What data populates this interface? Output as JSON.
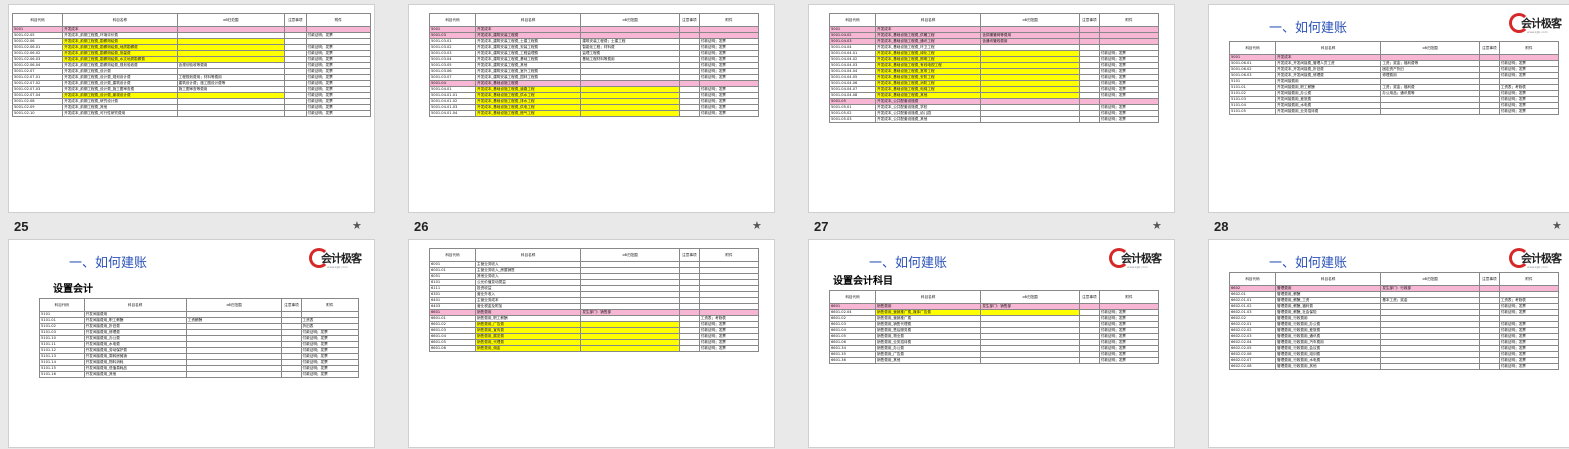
{
  "page_numbers": [
    "25",
    "26",
    "27",
    "28"
  ],
  "heading": "一、如何建账",
  "subheadings": {
    "s5": "设置会计",
    "s7": "设置会计科目"
  },
  "logo_text": "会计极客",
  "logo_url": "www.kjjk.com",
  "headers": [
    "科目代码",
    "科目名称",
    "об归范围",
    "注意事项",
    "附件"
  ],
  "slide1_rows": [
    {
      "code": "5001",
      "name": "开发成本",
      "pink": true
    },
    {
      "code": "5001.02.05",
      "name": "开发成本_前期工程费_环境评价费",
      "scope": "",
      "att": "付款证明；发票"
    },
    {
      "code": "5001.02.06",
      "name": "开发成本_前期工程费_勘察测绘费",
      "y": true
    },
    {
      "code": "5001.02.06.01",
      "name": "开发成本_前期工程费_勘察测绘费_地质勘察费",
      "y": true,
      "att": "付款证明；发票"
    },
    {
      "code": "5001.02.06.02",
      "name": "开发成本_前期工程费_勘察测绘费_测量费",
      "y": true,
      "att": "付款证明；发票"
    },
    {
      "code": "5001.02.06.03",
      "name": "开发成本_前期工程费_勘察测绘费_水文地质勘察费",
      "y": true,
      "att": "付款证明；发票"
    },
    {
      "code": "5001.02.06.04",
      "name": "开发成本_前期工程费_勘察测绘费_规划验收费",
      "scope": "含规划验收等费用",
      "att": "付款证明；发票"
    },
    {
      "code": "5001.02.07",
      "name": "开发成本_前期工程费_设计费",
      "att": "付款证明；发票"
    },
    {
      "code": "5001.02.07.01",
      "name": "开发成本_前期工程费_设计费_规划设计费",
      "scope": "工程规划费用；材料等费用",
      "att": "付款证明；发票"
    },
    {
      "code": "5001.02.07.02",
      "name": "开发成本_前期工程费_设计费_建筑设计费",
      "scope": "建筑设计费；施工图设计费等",
      "att": "付款证明；发票"
    },
    {
      "code": "5001.02.07.03",
      "name": "开发成本_前期工程费_设计费_施工图审查费",
      "scope": "施工图审查等费用",
      "att": "付款证明；发票"
    },
    {
      "code": "5001.02.07.04",
      "name": "开发成本_前期工程费_设计费_景观设计费",
      "y": true,
      "att": "付款证明；发票"
    },
    {
      "code": "5001.02.08",
      "name": "开发成本_前期工程费_研究设计费",
      "att": "付款证明；发票"
    },
    {
      "code": "5001.02.09",
      "name": "开发成本_前期工程费_其他",
      "att": "付款证明；发票"
    },
    {
      "code": "5001.02.10",
      "name": "开发成本_前期工程费_可行性研究费用",
      "att": "付款证明；发票"
    }
  ],
  "slide2_rows": [
    {
      "code": "5001",
      "name": "开发成本",
      "pink": true
    },
    {
      "code": "5001.03",
      "name": "开发成本_建筑安装工程费",
      "pink": true
    },
    {
      "code": "5001.03.01",
      "name": "开发成本_建筑安装工程费_土建工程费",
      "scope": "建筑安装工程费；土建工程",
      "att": "付款证明；发票"
    },
    {
      "code": "5001.03.02",
      "name": "开发成本_建筑安装工程费_安装工程费",
      "scope": "智能化工程；材料费",
      "att": "付款证明；发票"
    },
    {
      "code": "5001.03.03",
      "name": "开发成本_建筑安装工程费_工程监理费",
      "scope": "监理工程费",
      "att": "付款证明；发票"
    },
    {
      "code": "5001.03.04",
      "name": "开发成本_建筑安装工程费_基础工程费",
      "scope": "基础工程材料等费用",
      "att": "付款证明；发票"
    },
    {
      "code": "5001.03.05",
      "name": "开发成本_建筑安装工程费_其他",
      "att": "付款证明；发票"
    },
    {
      "code": "5001.03.06",
      "name": "开发成本_建筑安装工程费_室外工程费",
      "att": "付款证明；发票"
    },
    {
      "code": "5001.03.07",
      "name": "开发成本_建筑安装工程费_园林工程费",
      "att": "付款证明；发票"
    },
    {
      "code": "5001.04",
      "name": "开发成本_基础设施工程费",
      "pink": true
    },
    {
      "code": "5001.04.01",
      "name": "开发成本_基础设施工程费_道路工程",
      "y": true,
      "att": "付款证明；发票"
    },
    {
      "code": "5001.04.01.01",
      "name": "开发成本_基础设施工程费_供水工程",
      "y": true,
      "att": "付款证明；发票"
    },
    {
      "code": "5001.04.01.02",
      "name": "开发成本_基础设施工程费_排水工程",
      "y": true,
      "att": "付款证明；发票"
    },
    {
      "code": "5001.04.01.03",
      "name": "开发成本_基础设施工程费_供电工程",
      "y": true,
      "att": "付款证明；发票"
    },
    {
      "code": "5001.04.01.04",
      "name": "开发成本_基础设施工程费_燃气工程",
      "y": true,
      "att": "付款证明；发票"
    }
  ],
  "slide3_rows": [
    {
      "code": "5001",
      "name": "开发成本",
      "pink": true
    },
    {
      "code": "5001.04.02",
      "name": "开发成本_基础设施工程费_供暖工程",
      "scope": "含供暖管网等费用",
      "pink": true
    },
    {
      "code": "5001.04.03",
      "name": "开发成本_基础设施工程费_通讯工程",
      "scope": "含通讯管线费用",
      "pink": true
    },
    {
      "code": "5001.04.04",
      "name": "开发成本_基础设施工程费_环卫工程"
    },
    {
      "code": "5001.04.04.01",
      "name": "开发成本_基础设施工程费_绿化工程",
      "y": true,
      "att": "付款证明；发票"
    },
    {
      "code": "5001.04.04.02",
      "name": "开发成本_基础设施工程费_照明工程",
      "y": true,
      "att": "付款证明；发票"
    },
    {
      "code": "5001.04.04.03",
      "name": "开发成本_基础设施工程费_有线电视工程",
      "y": true,
      "att": "付款证明；发票"
    },
    {
      "code": "5001.04.04.04",
      "name": "开发成本_基础设施工程费_宽带工程",
      "y": true,
      "att": "付款证明；发票"
    },
    {
      "code": "5001.04.04.05",
      "name": "开发成本_基础设施工程费_安防工程",
      "y": true,
      "att": "付款证明；发票"
    },
    {
      "code": "5001.04.04.06",
      "name": "开发成本_基础设施工程费_消防工程",
      "y": true,
      "att": "付款证明；发票"
    },
    {
      "code": "5001.04.04.07",
      "name": "开发成本_基础设施工程费_电梯工程",
      "y": true,
      "att": "付款证明；发票"
    },
    {
      "code": "5001.04.04.08",
      "name": "开发成本_基础设施工程费_其他",
      "y": true,
      "att": "付款证明；发票"
    },
    {
      "code": "5001.05",
      "name": "开发成本_公共配套设施费",
      "pink": true
    },
    {
      "code": "5001.05.01",
      "name": "开发成本_公共配套设施费_学校",
      "att": "付款证明；发票"
    },
    {
      "code": "5001.05.02",
      "name": "开发成本_公共配套设施费_幼儿园",
      "att": "付款证明；发票"
    },
    {
      "code": "5001.05.03",
      "name": "开发成本_公共配套设施费_其他",
      "att": "付款证明；发票"
    }
  ],
  "slide4_rows": [
    {
      "code": "5001",
      "name": "开发成本",
      "pink": true
    },
    {
      "code": "5001.06.01",
      "name": "开发成本_开发间接费_管理人员工资",
      "scope": "工资；奖金；福利费等",
      "att": "付款证明；发票"
    },
    {
      "code": "5001.06.02",
      "name": "开发成本_开发间接费_折旧费",
      "scope": "固定资产折旧",
      "att": "付款证明；发票"
    },
    {
      "code": "5001.06.03",
      "name": "开发成本_开发间接费_修理费",
      "scope": "修理费用",
      "att": "付款证明；发票"
    },
    {
      "code": "5101",
      "name": "开发间接费用"
    },
    {
      "code": "5101.01",
      "name": "开发间接费用_职工薪酬",
      "scope": "工资；奖金；福利费",
      "att": "工资表；考勤表"
    },
    {
      "code": "5101.02",
      "name": "开发间接费用_办公费",
      "scope": "办公用品；通讯费等",
      "att": "付款证明；发票"
    },
    {
      "code": "5101.03",
      "name": "开发间接费用_差旅费",
      "att": "付款证明；发票"
    },
    {
      "code": "5101.04",
      "name": "开发间接费用_水电费",
      "att": "付款证明；发票"
    },
    {
      "code": "5101.05",
      "name": "开发间接费用_业务招待费",
      "att": "付款证明；发票"
    }
  ],
  "slide5_rows": [
    {
      "code": "5101",
      "name": "开发间接费用"
    },
    {
      "code": "5101.01",
      "name": "开发间接费用_职工薪酬",
      "scope": "工资薪酬",
      "att": "工资表"
    },
    {
      "code": "5101.02",
      "name": "开发间接费用_折旧费",
      "att": "折旧表"
    },
    {
      "code": "5101.03",
      "name": "开发间接费用_修理费",
      "att": "付款证明；发票"
    },
    {
      "code": "5101.10",
      "name": "开发间接费用_办公费",
      "att": "付款证明；发票"
    },
    {
      "code": "5101.11",
      "name": "开发间接费用_水电费",
      "att": "付款证明；发票"
    },
    {
      "code": "5101.12",
      "name": "开发间接费用_劳动保护费",
      "att": "付款证明；发票"
    },
    {
      "code": "5101.13",
      "name": "开发间接费用_周转房摊销",
      "att": "付款证明；发票"
    },
    {
      "code": "5101.14",
      "name": "开发间接费用_物料消耗",
      "att": "付款证明；发票"
    },
    {
      "code": "5101.15",
      "name": "开发间接费用_低值易耗品",
      "att": "付款证明；发票"
    },
    {
      "code": "5101.16",
      "name": "开发间接费用_其他",
      "att": "付款证明；发票"
    }
  ],
  "slide6_rows": [
    {
      "code": "6001",
      "name": "主营业务收入"
    },
    {
      "code": "6001.01",
      "name": "主营业务收入_房屋销售"
    },
    {
      "code": "6051",
      "name": "其他业务收入"
    },
    {
      "code": "6101",
      "name": "公允价值变动损益"
    },
    {
      "code": "6111",
      "name": "投资收益"
    },
    {
      "code": "6301",
      "name": "营业外收入"
    },
    {
      "code": "6401",
      "name": "主营业务成本"
    },
    {
      "code": "6403",
      "name": "营业税金及附加"
    },
    {
      "code": "6601",
      "name": "销售费用",
      "scope": "发生部门：销售部",
      "pink": true
    },
    {
      "code": "6601.01",
      "name": "销售费用_职工薪酬",
      "att": "工资表；考勤表"
    },
    {
      "code": "6601.02",
      "name": "销售费用_广告费",
      "y": true,
      "att": "付款证明；发票"
    },
    {
      "code": "6601.03",
      "name": "销售费用_宣传费",
      "y": true,
      "att": "付款证明；发票"
    },
    {
      "code": "6601.04",
      "name": "销售费用_展览费",
      "y": true,
      "att": "付款证明；发票"
    },
    {
      "code": "6601.05",
      "name": "销售费用_代理费",
      "y": true,
      "att": "付款证明；发票"
    },
    {
      "code": "6601.06",
      "name": "销售费用_佣金",
      "y": true,
      "att": "付款证明；发票"
    }
  ],
  "slide7_rows": [
    {
      "code": "6601",
      "name": "销售费用",
      "scope": "发生部门：销售部",
      "pink": true
    },
    {
      "code": "6601.02.04",
      "name": "销售费用_营销推广费_媒体广告费",
      "y": true,
      "att": "付款证明；发票"
    },
    {
      "code": "6601.02",
      "name": "销售费用_营销推广费",
      "att": "付款证明；发票"
    },
    {
      "code": "6601.03",
      "name": "销售费用_销售代理费",
      "att": "付款证明；发票"
    },
    {
      "code": "6601.04",
      "name": "销售费用_售后服务费",
      "att": "付款证明；发票"
    },
    {
      "code": "6601.05",
      "name": "销售费用_物业费",
      "att": "付款证明；发票"
    },
    {
      "code": "6601.06",
      "name": "销售费用_业务招待费",
      "att": "付款证明；发票"
    },
    {
      "code": "6601.34",
      "name": "销售费用_办公费",
      "att": "付款证明；发票"
    },
    {
      "code": "6601.35",
      "name": "销售费用_广告费",
      "att": "付款证明；发票"
    },
    {
      "code": "6601.36",
      "name": "销售费用_其他",
      "att": "付款证明；发票"
    }
  ],
  "slide8_rows": [
    {
      "code": "6602",
      "name": "管理费用",
      "scope": "发生部门：行政部",
      "pink": true
    },
    {
      "code": "6602.01",
      "name": "管理费用_薪酬"
    },
    {
      "code": "6602.01.01",
      "name": "管理费用_薪酬_工资",
      "scope": "基本工资；奖金",
      "att": "工资表；考勤表"
    },
    {
      "code": "6602.01.02",
      "name": "管理费用_薪酬_福利费",
      "att": "付款证明；发票"
    },
    {
      "code": "6602.01.03",
      "name": "管理费用_薪酬_社会保险",
      "att": "付款证明；发票"
    },
    {
      "code": "6602.02",
      "name": "管理费用_行政费用"
    },
    {
      "code": "6602.02.01",
      "name": "管理费用_行政费用_办公费",
      "att": "付款证明；发票"
    },
    {
      "code": "6602.02.02",
      "name": "管理费用_行政费用_差旅费",
      "att": "付款证明；发票"
    },
    {
      "code": "6602.02.03",
      "name": "管理费用_行政费用_通讯费",
      "att": "付款证明；发票"
    },
    {
      "code": "6602.02.04",
      "name": "管理费用_行政费用_汽车费用",
      "att": "付款证明；发票"
    },
    {
      "code": "6602.02.05",
      "name": "管理费用_行政费用_会议费",
      "att": "付款证明；发票"
    },
    {
      "code": "6602.02.06",
      "name": "管理费用_行政费用_培训费",
      "att": "付款证明；发票"
    },
    {
      "code": "6602.02.07",
      "name": "管理费用_行政费用_水电费",
      "att": "付款证明；发票"
    },
    {
      "code": "6602.02.08",
      "name": "管理费用_行政费用_其他",
      "att": "付款证明；发票"
    }
  ]
}
